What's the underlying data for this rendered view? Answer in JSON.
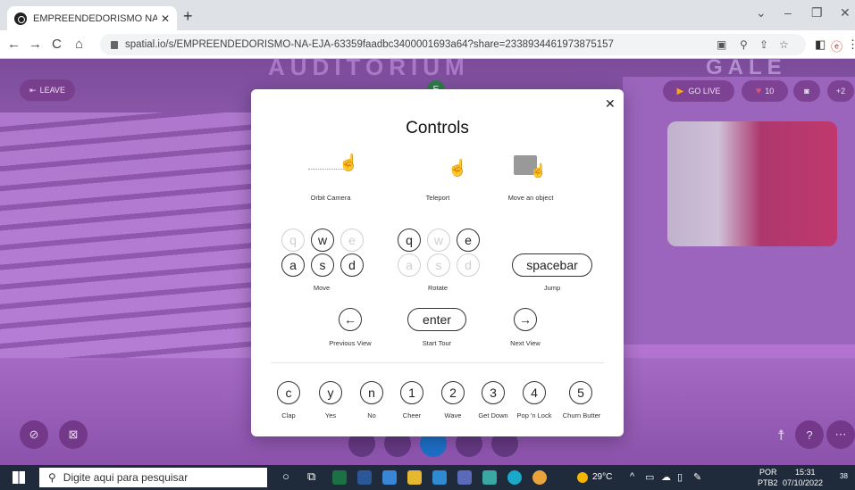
{
  "browser": {
    "tab_title": "EMPREENDEDORISMO NA EJA | ",
    "tab_close": "✕",
    "new_tab": "+",
    "url": "spatial.io/s/EMPREENDEDORISMO-NA-EJA-63359faadbc3400001693a64?share=2338934461973875157",
    "window_controls": [
      "⌄",
      "–",
      "❐",
      "✕"
    ]
  },
  "scene": {
    "sign_left": "AUDITORIUM",
    "sign_right": "GALE",
    "leave": "LEAVE",
    "go_live": "GO LIVE",
    "likes": "10",
    "add_people": "+2",
    "avatar_initial": "E"
  },
  "modal": {
    "title": "Controls",
    "close": "✕",
    "mouse_controls": [
      {
        "label": "Orbit Camera",
        "icon": "orbit-hand-icon"
      },
      {
        "label": "Teleport",
        "icon": "pointer-hand-icon"
      },
      {
        "label": "Move an object",
        "icon": "move-object-icon"
      }
    ],
    "move_keys": {
      "row1": [
        "q",
        "w",
        "e"
      ],
      "row2": [
        "a",
        "s",
        "d"
      ],
      "label": "Move"
    },
    "rotate_keys": {
      "row1": [
        "q",
        "w",
        "e"
      ],
      "row2": [
        "a",
        "s",
        "d"
      ],
      "label": "Rotate"
    },
    "jump": {
      "key": "spacebar",
      "label": "Jump"
    },
    "nav": [
      {
        "key": "←",
        "label": "Previous View"
      },
      {
        "key": "enter",
        "label": "Start Tour"
      },
      {
        "key": "→",
        "label": "Next View"
      }
    ],
    "emotes": [
      {
        "key": "c",
        "label": "Clap"
      },
      {
        "key": "y",
        "label": "Yes"
      },
      {
        "key": "n",
        "label": "No"
      },
      {
        "key": "1",
        "label": "Cheer"
      },
      {
        "key": "2",
        "label": "Wave"
      },
      {
        "key": "3",
        "label": "Get Down"
      },
      {
        "key": "4",
        "label": "Pop 'n Lock"
      },
      {
        "key": "5",
        "label": "Churn Butter"
      }
    ]
  },
  "taskbar": {
    "search_placeholder": "Digite aqui para pesquisar",
    "temperature": "29°C",
    "lang_top": "POR",
    "lang_bottom": "PTB2",
    "time": "15:31",
    "date": "07/10/2022",
    "notifications": "38"
  }
}
